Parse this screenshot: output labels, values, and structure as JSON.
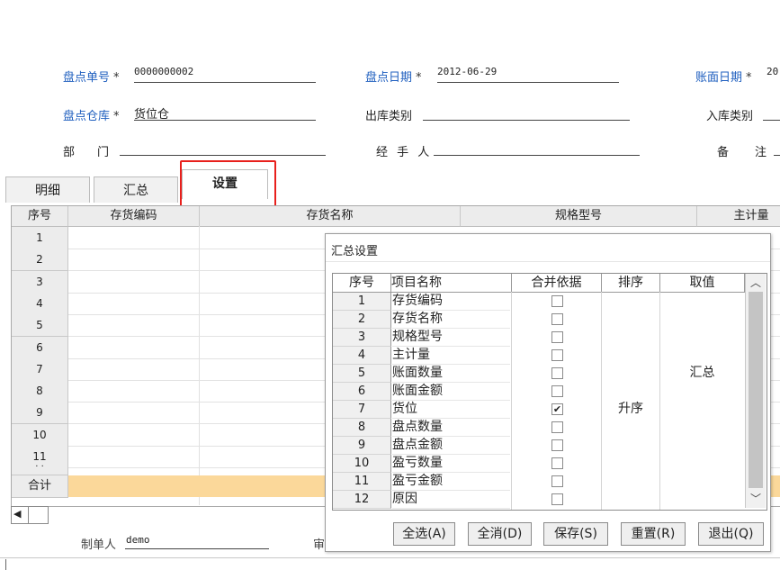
{
  "form": {
    "fields": [
      {
        "label": "盘点单号",
        "required": true,
        "value": "0000000002"
      },
      {
        "label": "盘点日期",
        "required": true,
        "value": "2012-06-29"
      },
      {
        "label": "账面日期",
        "required": true,
        "value": "20"
      },
      {
        "label": "盘点仓库",
        "required": true,
        "value": "货位仓"
      },
      {
        "label": "出库类别",
        "required": false,
        "value": ""
      },
      {
        "label": "入库类别",
        "required": false,
        "value": ""
      },
      {
        "label": "部　门",
        "required": false,
        "value": ""
      },
      {
        "label": "经 手 人",
        "required": false,
        "value": ""
      },
      {
        "label": "备　注",
        "required": false,
        "value": ""
      }
    ],
    "required_mark": "*"
  },
  "tabs": [
    {
      "label": "明细",
      "active": false
    },
    {
      "label": "汇总",
      "active": false
    },
    {
      "label": "设置",
      "active": true
    }
  ],
  "grid": {
    "columns": [
      "序号",
      "存货编码",
      "存货名称",
      "规格型号",
      "主计量"
    ],
    "rows": [
      "1",
      "2",
      "3",
      "4",
      "5",
      "6",
      "7",
      "8",
      "9",
      "10",
      "11"
    ],
    "partial_row": "· ·",
    "sum_label": "合计",
    "scroll_left": "◀"
  },
  "footer": {
    "maker_label": "制单人",
    "maker_value": "demo",
    "auditor_label": "审"
  },
  "dialog": {
    "title": "汇总设置",
    "columns": [
      "序号",
      "项目名称",
      "合并依据",
      "排序",
      "取值"
    ],
    "rows": [
      {
        "num": "1",
        "name": "存货编码",
        "merge": false,
        "sort": "",
        "value": ""
      },
      {
        "num": "2",
        "name": "存货名称",
        "merge": false,
        "sort": "",
        "value": ""
      },
      {
        "num": "3",
        "name": "规格型号",
        "merge": false,
        "sort": "",
        "value": ""
      },
      {
        "num": "4",
        "name": "主计量",
        "merge": false,
        "sort": "",
        "value": ""
      },
      {
        "num": "5",
        "name": "账面数量",
        "merge": false,
        "sort": "",
        "value": "汇总"
      },
      {
        "num": "6",
        "name": "账面金额",
        "merge": false,
        "sort": "",
        "value": ""
      },
      {
        "num": "7",
        "name": "货位",
        "merge": true,
        "sort": "升序",
        "value": ""
      },
      {
        "num": "8",
        "name": "盘点数量",
        "merge": false,
        "sort": "",
        "value": ""
      },
      {
        "num": "9",
        "name": "盘点金额",
        "merge": false,
        "sort": "",
        "value": ""
      },
      {
        "num": "10",
        "name": "盈亏数量",
        "merge": false,
        "sort": "",
        "value": ""
      },
      {
        "num": "11",
        "name": "盈亏金额",
        "merge": false,
        "sort": "",
        "value": ""
      },
      {
        "num": "12",
        "name": "原因",
        "merge": false,
        "sort": "",
        "value": ""
      }
    ],
    "scroll_up": "︿",
    "scroll_down": "﹀",
    "check_mark": "✔",
    "buttons": [
      "全选(A)",
      "全消(D)",
      "保存(S)",
      "重置(R)",
      "退出(Q)"
    ]
  },
  "colors": {
    "label_blue": "#1f5fbf",
    "highlight_red": "#e8201c",
    "sum_row": "#fbd89a"
  }
}
